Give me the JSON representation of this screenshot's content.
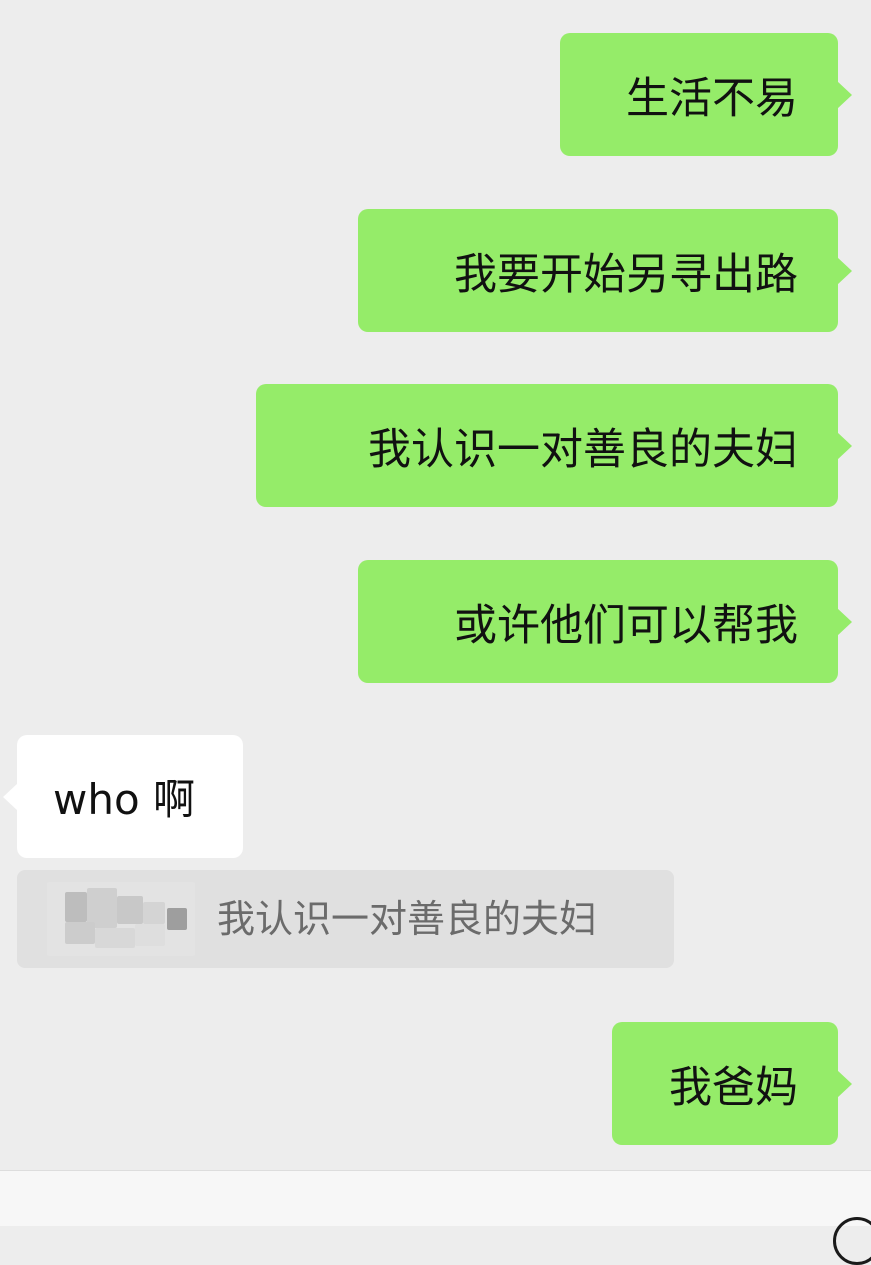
{
  "messages": [
    {
      "text": "生活不易"
    },
    {
      "text": "我要开始另寻出路"
    },
    {
      "text": "我认识一对善良的夫妇"
    },
    {
      "text": "或许他们可以帮我"
    },
    {
      "text": "who 啊"
    },
    {
      "text": "我爸妈"
    }
  ],
  "quote": {
    "text": "我认识一对善良的夫妇",
    "avatar_icon": "blurred-avatar"
  },
  "colors": {
    "outgoing_bubble": "#95ec69",
    "incoming_bubble": "#ffffff",
    "background": "#ededed",
    "quote_background": "#e0e0e0"
  },
  "icons": {
    "input_bar_right": "plus-circle-icon"
  }
}
